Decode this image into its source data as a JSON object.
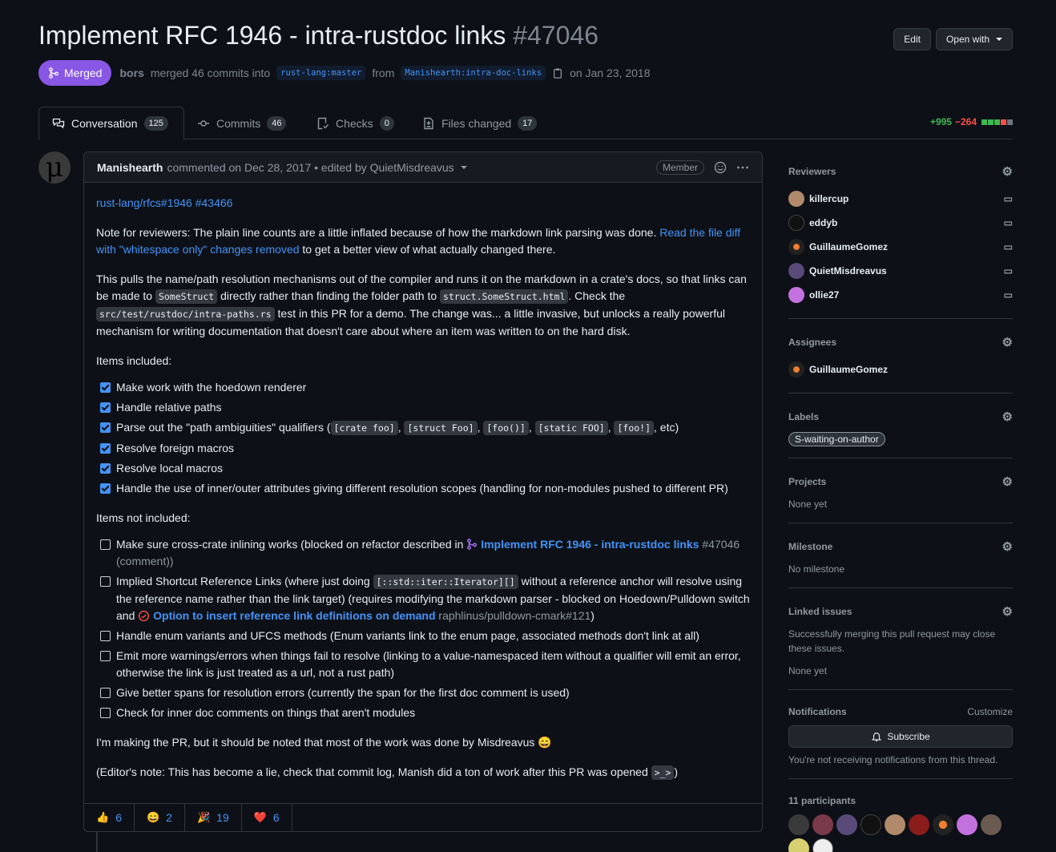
{
  "header": {
    "title": "Implement RFC 1946 - intra-rustdoc links",
    "number": "#47046",
    "edit_label": "Edit",
    "open_with_label": "Open with"
  },
  "meta": {
    "state": "Merged",
    "user": "bors",
    "text1": "merged 46 commits into",
    "base_branch": "rust-lang:master",
    "text2": "from",
    "head_branch": "Manishearth:intra-doc-links",
    "date": "on Jan 23, 2018"
  },
  "tabs": [
    {
      "label": "Conversation",
      "count": "125"
    },
    {
      "label": "Commits",
      "count": "46"
    },
    {
      "label": "Checks",
      "count": "0"
    },
    {
      "label": "Files changed",
      "count": "17"
    }
  ],
  "diffstat": {
    "additions": "+995",
    "deletions": "−264"
  },
  "comment": {
    "author": "Manishearth",
    "header_text": "commented on Dec 28, 2017 • edited by QuietMisdreavus",
    "role": "Member",
    "links_line": "rust-lang/rfcs#1946 #43466",
    "p1_a": "Note for reviewers: The plain line counts are a little inflated because of how the markdown link parsing was done.",
    "p1_link": "Read the file diff with \"whitespace only\" changes removed",
    "p1_b": "to get a better view of what actually changed there.",
    "p2_a": "This pulls the name/path resolution mechanisms out of the compiler and runs it on the markdown in a crate's docs, so that links can be made to",
    "p2_code1": "SomeStruct",
    "p2_b": "directly rather than finding the folder path to",
    "p2_code2": "struct.SomeStruct.html",
    "p2_c": ". Check the",
    "p2_code3": "src/test/rustdoc/intra-paths.rs",
    "p2_d": "test in this PR for a demo. The change was... a little invasive, but unlocks a really powerful mechanism for writing documentation that doesn't care about where an item was written to on the hard disk.",
    "included_heading": "Items included:",
    "included": [
      "Make work with the hoedown renderer",
      "Handle relative paths",
      "Parse out the \"path ambiguities\" qualifiers (",
      "Resolve foreign macros",
      "Resolve local macros",
      "Handle the use of inner/outer attributes giving different resolution scopes (handling for non-modules pushed to different PR)"
    ],
    "qualifier_codes": [
      "[crate foo]",
      "[struct Foo]",
      "[foo()]",
      "[static FOO]",
      "[foo!]"
    ],
    "qualifier_tail": ", etc)",
    "not_included_heading": "Items not included:",
    "not1_a": "Make sure cross-crate inlining works (blocked on refactor described in",
    "not1_ref": "Implement RFC 1946 - intra-rustdoc links",
    "not1_num": "#47046",
    "not1_b": "(comment))",
    "not2_a": "Implied Shortcut Reference Links (where just doing",
    "not2_code": "[::std::iter::Iterator][]",
    "not2_b": "without a reference anchor will resolve using the reference name rather than the link target) (requires modifying the markdown parser - blocked on Hoedown/Pulldown switch and",
    "not2_ref": "Option to insert reference link definitions on demand",
    "not2_repo": "raphlinus/pulldown-cmark#121",
    "not2_c": ")",
    "not3": "Handle enum variants and UFCS methods (Enum variants link to the enum page, associated methods don't link at all)",
    "not4": "Emit more warnings/errors when things fail to resolve (linking to a value-namespaced item without a qualifier will emit an error, otherwise the link is just treated as a url, not a rust path)",
    "not5": "Give better spans for resolution errors (currently the span for the first doc comment is used)",
    "not6": "Check for inner doc comments on things that aren't modules",
    "p3": "I'm making the PR, but it should be noted that most of the work was done by Misdreavus 😄",
    "p4_a": "(Editor's note: This has become a lie, check that commit log, Manish did a ton of work after this PR was opened",
    "p4_code": ">_>",
    "p4_b": ")",
    "reactions": [
      {
        "emoji": "👍",
        "count": "6"
      },
      {
        "emoji": "😄",
        "count": "2"
      },
      {
        "emoji": "🎉",
        "count": "19"
      },
      {
        "emoji": "❤️",
        "count": "6"
      }
    ]
  },
  "sidebar": {
    "reviewers_title": "Reviewers",
    "reviewers": [
      "killercup",
      "eddyb",
      "GuillaumeGomez",
      "QuietMisdreavus",
      "ollie27"
    ],
    "assignees_title": "Assignees",
    "assignees": [
      "GuillaumeGomez"
    ],
    "labels_title": "Labels",
    "label": "S-waiting-on-author",
    "projects_title": "Projects",
    "projects_value": "None yet",
    "milestone_title": "Milestone",
    "milestone_value": "No milestone",
    "linked_title": "Linked issues",
    "linked_desc": "Successfully merging this pull request may close these issues.",
    "linked_value": "None yet",
    "notifications_title": "Notifications",
    "customize_label": "Customize",
    "subscribe_label": "Subscribe",
    "notif_text": "You're not receiving notifications from this thread.",
    "participants_title": "11 participants"
  },
  "colors": {
    "merged": "#8957e5",
    "link": "#4493f8",
    "add": "#3fb950",
    "del": "#f85149"
  }
}
